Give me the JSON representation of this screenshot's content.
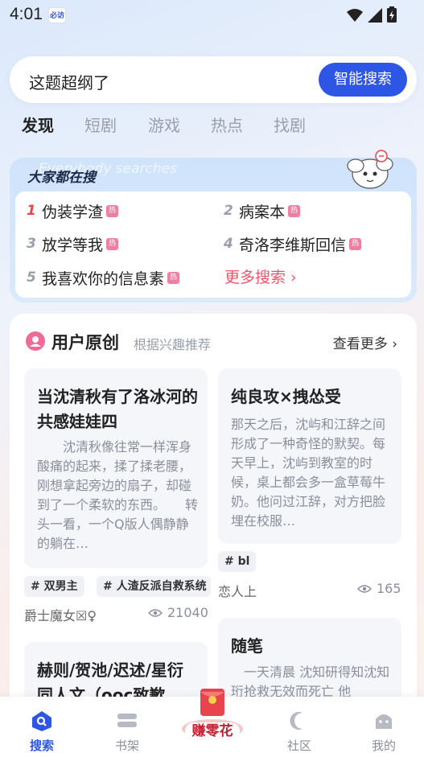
{
  "status_bar": {
    "time": "4:01",
    "app_icon_text": "必访"
  },
  "search": {
    "query": "这题超纲了",
    "button_label": "智能搜索"
  },
  "top_tabs": [
    {
      "label": "发现",
      "active": true
    },
    {
      "label": "短剧",
      "active": false
    },
    {
      "label": "游戏",
      "active": false
    },
    {
      "label": "热点",
      "active": false
    },
    {
      "label": "找剧",
      "active": false
    }
  ],
  "hot_search": {
    "title": "大家都在搜",
    "watermark": "Everybody searches",
    "badge_text": "热",
    "items": [
      {
        "rank": "1",
        "label": "伪装学渣",
        "hot": true
      },
      {
        "rank": "2",
        "label": "病案本",
        "hot": true
      },
      {
        "rank": "3",
        "label": "放学等我",
        "hot": true
      },
      {
        "rank": "4",
        "label": "奇洛李维斯回信",
        "hot": true
      },
      {
        "rank": "5",
        "label": "我喜欢你的信息素",
        "hot": true
      }
    ],
    "more_label": "更多搜索 ›"
  },
  "ugc": {
    "title": "用户原创",
    "subtitle": "根据兴趣推荐",
    "more_label": "查看更多 ›",
    "cards": [
      {
        "title": "当沈清秋有了洛冰河的共感娃娃四",
        "excerpt": "　　沈清秋像往常一样浑身酸痛的起来，揉了揉老腰，刚想拿起旁边的扇子，却碰到了一个柔软的东西。　　转头一看，一个Q版人偶静静的躺在…",
        "tags": [
          "# 双男主",
          "# 人渣反派自救系统"
        ],
        "author": "爵士魔女☒♀",
        "views": "21040"
      },
      {
        "title": "纯良攻×拽怂受",
        "excerpt": "那天之后，沈屿和江辞之间形成了一种奇怪的默契。每天早上，沈屿到教室的时候，桌上都会多一盒草莓牛奶。他问过江辞，对方把脸埋在校服…",
        "tags": [
          "# bl"
        ],
        "author": "恋人上",
        "views": "165"
      },
      {
        "title": "赫则/贺池/迟述/星衍同人文（ooc致歉",
        "excerpt": ""
      },
      {
        "title": "随笔",
        "excerpt": "　一天清晨 沈知研得知沈知珩抢救无效而死亡 他"
      }
    ]
  },
  "bottom_nav": [
    {
      "label": "搜索",
      "icon": "search-nav-icon",
      "active": true
    },
    {
      "label": "书架",
      "icon": "bookshelf-icon",
      "active": false
    },
    {
      "label": "赚零花",
      "icon": "red-packet-icon",
      "active": false
    },
    {
      "label": "社区",
      "icon": "community-icon",
      "active": false
    },
    {
      "label": "我的",
      "icon": "profile-icon",
      "active": false
    }
  ],
  "colors": {
    "accent": "#2e56e6",
    "hot_red": "#e8434f",
    "hot_badge": "#ef7ea0",
    "earn_red": "#e8434f"
  }
}
